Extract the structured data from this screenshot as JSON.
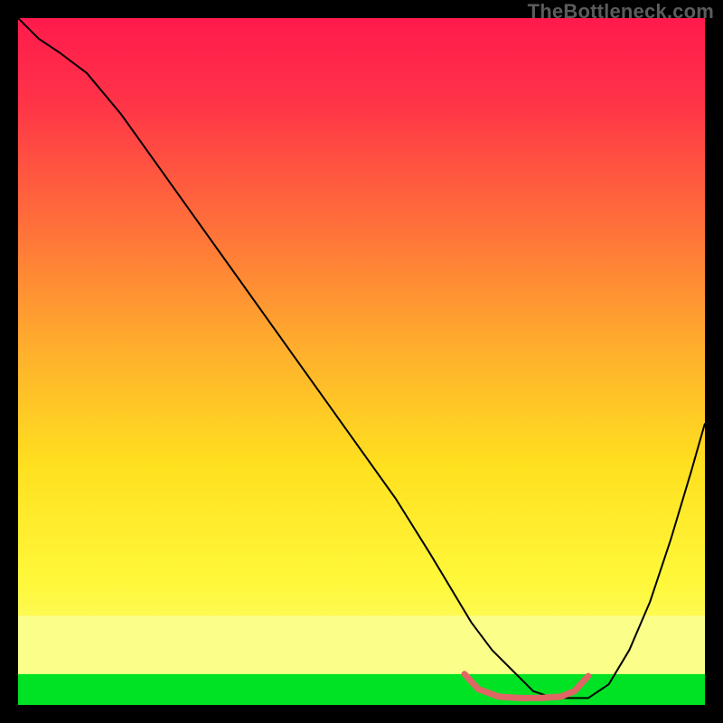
{
  "watermark": "TheBottleneck.com",
  "chart_data": {
    "type": "line",
    "title": "",
    "xlabel": "",
    "ylabel": "",
    "xlim": [
      0,
      100
    ],
    "ylim": [
      0,
      100
    ],
    "grid": false,
    "legend": false,
    "series": [
      {
        "name": "curve",
        "stroke": "#000000",
        "stroke_width": 2,
        "x": [
          0,
          3,
          6,
          10,
          15,
          20,
          25,
          30,
          35,
          40,
          45,
          50,
          55,
          60,
          63,
          66,
          69,
          72,
          75,
          78,
          80,
          83,
          86,
          89,
          92,
          95,
          98,
          100
        ],
        "y": [
          100,
          97,
          95,
          92,
          86,
          79,
          72,
          65,
          58,
          51,
          44,
          37,
          30,
          22,
          17,
          12,
          8,
          5,
          2,
          1,
          1,
          1,
          3,
          8,
          15,
          24,
          34,
          41
        ]
      },
      {
        "name": "green-band",
        "fill": "#00e324",
        "x": [
          0,
          100,
          100,
          0
        ],
        "y": [
          4.5,
          4.5,
          0,
          0
        ]
      },
      {
        "name": "yellow-band",
        "fill": "#fbff8a",
        "x": [
          0,
          100,
          100,
          0
        ],
        "y": [
          13,
          13,
          4.5,
          4.5
        ]
      },
      {
        "name": "trough-marker",
        "stroke": "#e06666",
        "stroke_width": 7,
        "linecap": "round",
        "x": [
          65,
          67,
          70,
          73,
          76,
          79,
          81,
          83
        ],
        "y": [
          4.5,
          2.3,
          1.2,
          1.0,
          1.0,
          1.2,
          2.0,
          4.2
        ]
      }
    ]
  }
}
